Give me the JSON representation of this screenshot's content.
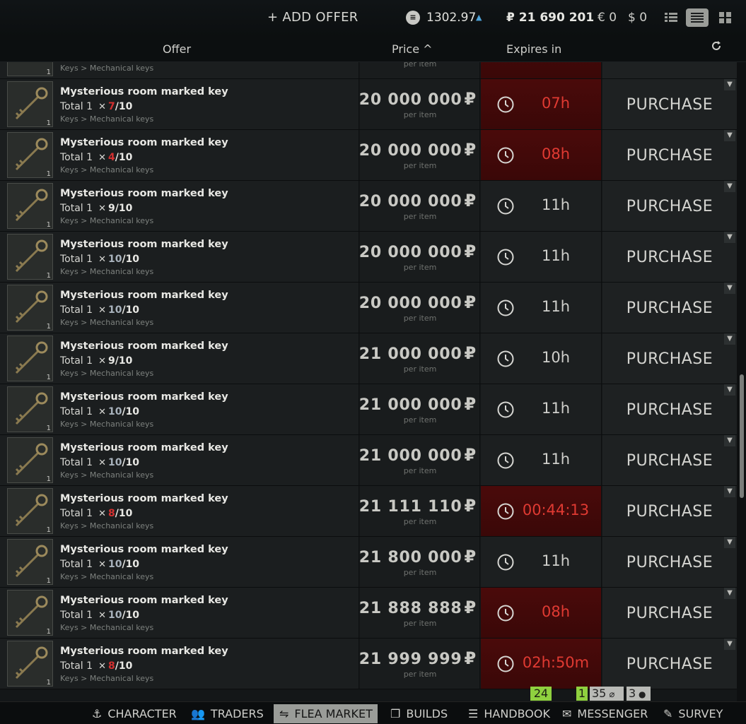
{
  "header": {
    "add_offer": "+ ADD OFFER",
    "rating": "1302.97",
    "roubles": "₽ 21 690 201",
    "euros": "€ 0",
    "dollars": "$ 0"
  },
  "columns": {
    "offer": "Offer",
    "price": "Price ^",
    "expires": "Expires in"
  },
  "partial_top_row": {
    "thumb_count": "1",
    "category": "Keys > Mechanical keys",
    "per_item": "per item"
  },
  "rows": [
    {
      "name": "Mysterious room marked key",
      "total": "Total 1",
      "dur_now": "7",
      "dur_class": "low",
      "dur_max": "/10",
      "category": "Keys > Mechanical keys",
      "price": "20 000 000",
      "currency": "₽",
      "per_item": "per item",
      "expires": "07h",
      "urgent": true,
      "action": "PURCHASE",
      "thumb_count": "1"
    },
    {
      "name": "Mysterious room marked key",
      "total": "Total 1",
      "dur_now": "4",
      "dur_class": "low",
      "dur_max": "/10",
      "category": "Keys > Mechanical keys",
      "price": "20 000 000",
      "currency": "₽",
      "per_item": "per item",
      "expires": "08h",
      "urgent": true,
      "action": "PURCHASE",
      "thumb_count": "1"
    },
    {
      "name": "Mysterious room marked key",
      "total": "Total 1",
      "dur_now": "9",
      "dur_class": "mid",
      "dur_max": "/10",
      "category": "Keys > Mechanical keys",
      "price": "20 000 000",
      "currency": "₽",
      "per_item": "per item",
      "expires": "11h",
      "urgent": false,
      "action": "PURCHASE",
      "thumb_count": "1"
    },
    {
      "name": "Mysterious room marked key",
      "total": "Total 1",
      "dur_now": "10",
      "dur_class": "full",
      "dur_max": "/10",
      "category": "Keys > Mechanical keys",
      "price": "20 000 000",
      "currency": "₽",
      "per_item": "per item",
      "expires": "11h",
      "urgent": false,
      "action": "PURCHASE",
      "thumb_count": "1"
    },
    {
      "name": "Mysterious room marked key",
      "total": "Total 1",
      "dur_now": "10",
      "dur_class": "full",
      "dur_max": "/10",
      "category": "Keys > Mechanical keys",
      "price": "20 000 000",
      "currency": "₽",
      "per_item": "per item",
      "expires": "11h",
      "urgent": false,
      "action": "PURCHASE",
      "thumb_count": "1"
    },
    {
      "name": "Mysterious room marked key",
      "total": "Total 1",
      "dur_now": "9",
      "dur_class": "mid",
      "dur_max": "/10",
      "category": "Keys > Mechanical keys",
      "price": "21 000 000",
      "currency": "₽",
      "per_item": "per item",
      "expires": "10h",
      "urgent": false,
      "action": "PURCHASE",
      "thumb_count": "1"
    },
    {
      "name": "Mysterious room marked key",
      "total": "Total 1",
      "dur_now": "10",
      "dur_class": "full",
      "dur_max": "/10",
      "category": "Keys > Mechanical keys",
      "price": "21 000 000",
      "currency": "₽",
      "per_item": "per item",
      "expires": "11h",
      "urgent": false,
      "action": "PURCHASE",
      "thumb_count": "1"
    },
    {
      "name": "Mysterious room marked key",
      "total": "Total 1",
      "dur_now": "10",
      "dur_class": "full",
      "dur_max": "/10",
      "category": "Keys > Mechanical keys",
      "price": "21 000 000",
      "currency": "₽",
      "per_item": "per item",
      "expires": "11h",
      "urgent": false,
      "action": "PURCHASE",
      "thumb_count": "1"
    },
    {
      "name": "Mysterious room marked key",
      "total": "Total 1",
      "dur_now": "8",
      "dur_class": "low",
      "dur_max": "/10",
      "category": "Keys > Mechanical keys",
      "price": "21 111 110",
      "currency": "₽",
      "per_item": "per item",
      "expires": "00:44:13",
      "urgent": true,
      "action": "PURCHASE",
      "thumb_count": "1"
    },
    {
      "name": "Mysterious room marked key",
      "total": "Total 1",
      "dur_now": "10",
      "dur_class": "full",
      "dur_max": "/10",
      "category": "Keys > Mechanical keys",
      "price": "21 800 000",
      "currency": "₽",
      "per_item": "per item",
      "expires": "11h",
      "urgent": false,
      "action": "PURCHASE",
      "thumb_count": "1"
    },
    {
      "name": "Mysterious room marked key",
      "total": "Total 1",
      "dur_now": "10",
      "dur_class": "full",
      "dur_max": "/10",
      "category": "Keys > Mechanical keys",
      "price": "21 888 888",
      "currency": "₽",
      "per_item": "per item",
      "expires": "08h",
      "urgent": true,
      "action": "PURCHASE",
      "thumb_count": "1"
    },
    {
      "name": "Mysterious room marked key",
      "total": "Total 1",
      "dur_now": "8",
      "dur_class": "low",
      "dur_max": "/10",
      "category": "Keys > Mechanical keys",
      "price": "21 999 999",
      "currency": "₽",
      "per_item": "per item",
      "expires": "02h:50m",
      "urgent": true,
      "action": "PURCHASE",
      "thumb_count": "1"
    }
  ],
  "notifications": {
    "flea": "24",
    "messenger_new": "1",
    "messenger_attach": "35",
    "messenger_users": "3"
  },
  "nav": [
    {
      "label": "CHARACTER",
      "icon": "character-icon",
      "glyph": "⚓"
    },
    {
      "label": "TRADERS",
      "icon": "traders-icon",
      "glyph": "👥"
    },
    {
      "label": "FLEA MARKET",
      "icon": "flea-market-icon",
      "glyph": "⇋",
      "active": true
    },
    {
      "label": "BUILDS",
      "icon": "builds-icon",
      "glyph": "❐"
    },
    {
      "label": "HANDBOOK",
      "icon": "handbook-icon",
      "glyph": "☰"
    },
    {
      "label": "MESSENGER",
      "icon": "messenger-icon",
      "glyph": "✉"
    },
    {
      "label": "SURVEY",
      "icon": "survey-icon",
      "glyph": "✎"
    }
  ],
  "colors": {
    "urgent": "#e03a32",
    "durability_low": "#d43030",
    "notify_green": "#8fd13f",
    "active_tab": "#9a9c98"
  }
}
